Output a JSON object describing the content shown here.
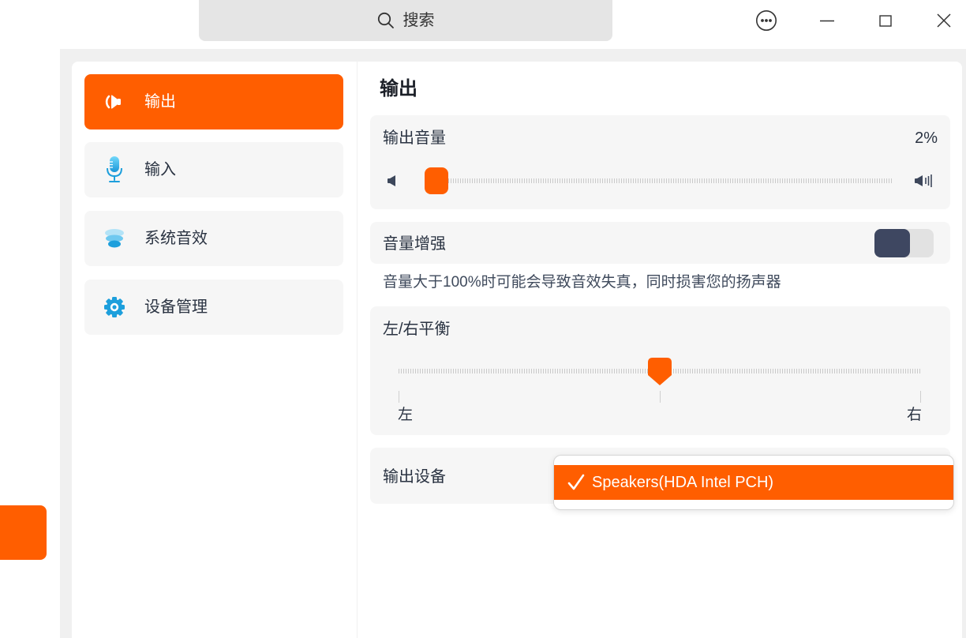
{
  "window": {
    "search": {
      "placeholder": "搜索",
      "icon": "search-icon"
    },
    "controls": [
      "more-icon",
      "minimize-icon",
      "maximize-icon",
      "close-icon"
    ]
  },
  "sidebar": {
    "items": [
      {
        "label": "输出",
        "icon": "speaker-icon",
        "selected": true
      },
      {
        "label": "输入",
        "icon": "microphone-icon",
        "selected": false
      },
      {
        "label": "系统音效",
        "icon": "system-sound-icon",
        "selected": false
      },
      {
        "label": "设备管理",
        "icon": "gear-icon",
        "selected": false
      }
    ]
  },
  "main": {
    "title": "输出",
    "volume": {
      "label": "输出音量",
      "value_text": "2%",
      "level": 0.02,
      "low_icon": "volume-low-icon",
      "high_icon": "volume-high-icon"
    },
    "boost": {
      "label": "音量增强",
      "enabled": false,
      "description": "音量大于100%时可能会导致音效失真，同时损害您的扬声器"
    },
    "balance": {
      "label": "左/右平衡",
      "left_label": "左",
      "right_label": "右",
      "level": 0.5
    },
    "output_device": {
      "label": "输出设备",
      "dropdown_open": true,
      "options": [
        {
          "label": "Speakers(HDA Intel PCH)",
          "selected": true,
          "icon": "checkmark-icon"
        }
      ]
    }
  },
  "colors": {
    "accent": "#ff5e00",
    "toggle_off_knob": "#3e4761",
    "icon_blue": "#1d9fdc",
    "card_bg": "#f6f6f6"
  }
}
